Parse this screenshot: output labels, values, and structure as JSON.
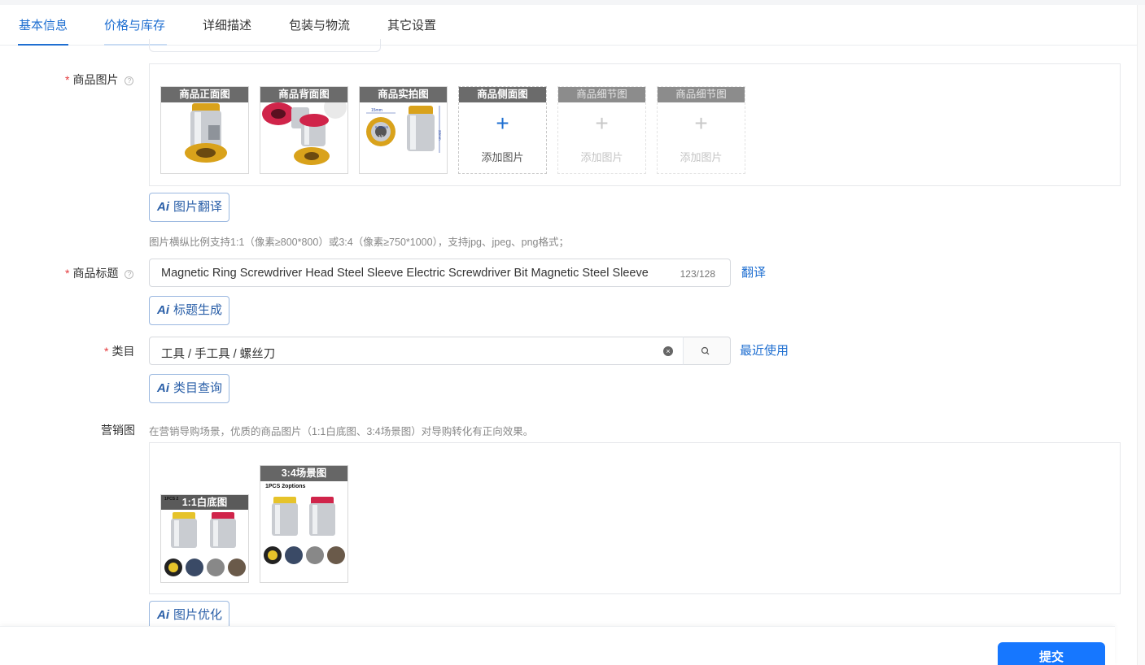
{
  "tabs": [
    {
      "label": "基本信息"
    },
    {
      "label": "价格与库存"
    },
    {
      "label": "详细描述"
    },
    {
      "label": "包装与物流"
    },
    {
      "label": "其它设置"
    }
  ],
  "product_images": {
    "label": "商品图片",
    "slots": [
      {
        "caption": "商品正面图"
      },
      {
        "caption": "商品背面图"
      },
      {
        "caption": "商品实拍图"
      },
      {
        "caption": "商品侧面图",
        "add_text": "添加图片"
      },
      {
        "caption": "商品细节图",
        "add_text": "添加图片"
      },
      {
        "caption": "商品细节图",
        "add_text": "添加图片"
      }
    ],
    "ai_button": "图片翻译",
    "hint": "图片横纵比例支持1:1（像素≥800*800）或3:4（像素≥750*1000），支持jpg、jpeg、png格式；"
  },
  "product_title": {
    "label": "商品标题",
    "value": "Magnetic Ring Screwdriver Head Steel Sleeve Electric Screwdriver Bit Magnetic Steel Sleeve",
    "counter": "123/128",
    "translate_link": "翻译",
    "ai_button": "标题生成"
  },
  "category": {
    "label": "类目",
    "value": "工具 / 手工具 / 螺丝刀",
    "recent_link": "最近使用",
    "ai_button": "类目查询"
  },
  "marketing": {
    "label": "营销图",
    "hint": "在营销导购场景，优质的商品图片（1:1白底图、3:4场景图）对导购转化有正向效果。",
    "slots": [
      {
        "caption": "1:1白底图",
        "image_text": "1PCS 2"
      },
      {
        "caption": "3:4场景图",
        "image_text": "1PCS 2options"
      }
    ],
    "ai_button": "图片优化"
  },
  "photo_labels": {
    "diameter": "15mm",
    "inner": "6.35mm",
    "inner_shape": "1/4",
    "height": "22mm"
  },
  "icons": {
    "help": "?",
    "plus": "+",
    "clear": "×",
    "ai": "Ai"
  },
  "submit": "提交",
  "colors": {
    "accent": "#1f6fd1",
    "primary_button": "#1677ff",
    "required": "#e4393c",
    "gold": "#d9a21b",
    "red": "#d0244a"
  }
}
